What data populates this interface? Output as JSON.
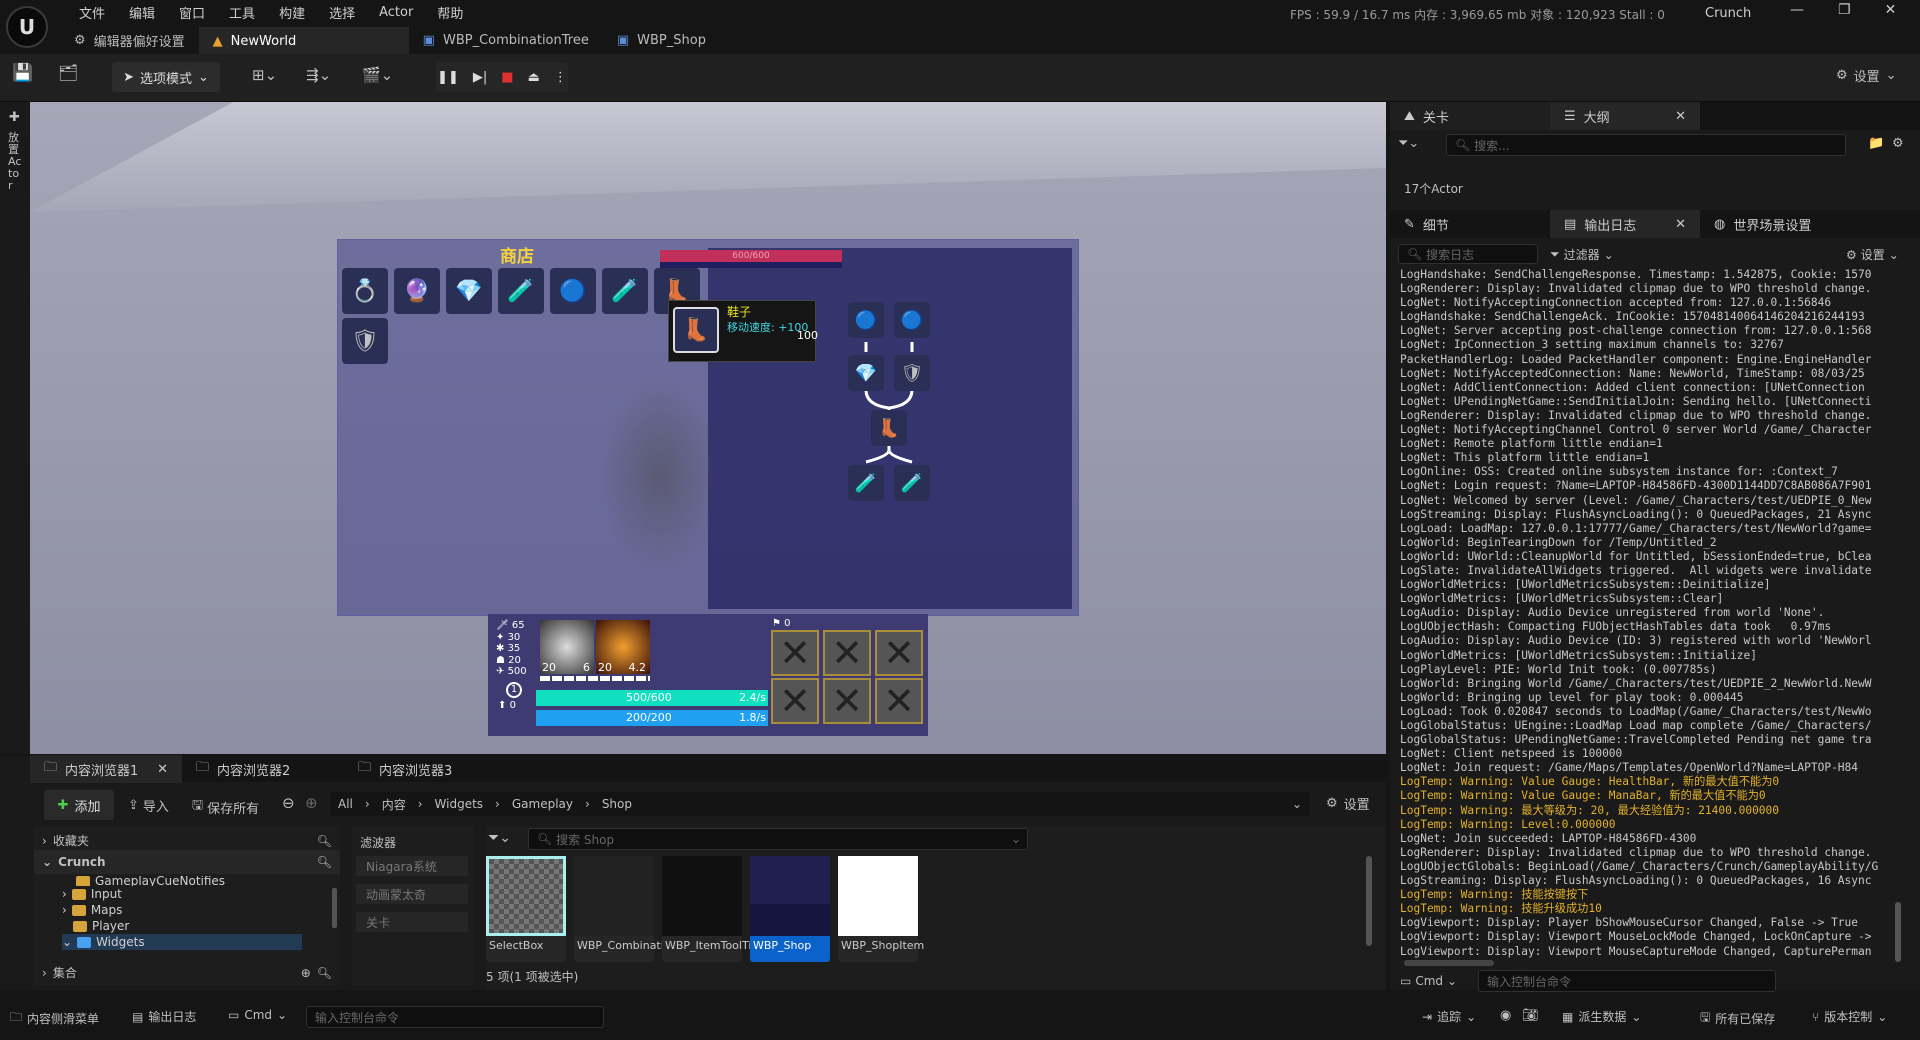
{
  "menu": [
    "文件",
    "编辑",
    "窗口",
    "工具",
    "构建",
    "选择",
    "Actor",
    "帮助"
  ],
  "doc_tabs": [
    "编辑器偏好设置",
    "NewWorld",
    "WBP_CombinationTree",
    "WBP_Shop"
  ],
  "stats": "FPS : 59.9 / 16.7 ms  内存 : 3,969.65 mb  对象 : 120,923  Stall : 0",
  "project": "Crunch",
  "toolbar": {
    "mode": "选项模式",
    "settings": "设置"
  },
  "left_strip": "放置Actor",
  "shop": {
    "title": "商店",
    "bar": "600/600",
    "tooltip_name": "鞋子",
    "tooltip_desc": "移动速度: +100",
    "tooltip_price": "100",
    "items": [
      "💍",
      "🔮",
      "💎",
      "🧪",
      "🔵",
      "🧪",
      "👢"
    ],
    "items_row2": [
      "🛡"
    ],
    "tree": [
      "🔵",
      "🔵",
      "💎",
      "🛡",
      "👢",
      "🧪",
      "🧪"
    ]
  },
  "hud": {
    "stats": [
      "65",
      "30",
      "35",
      "20",
      "500"
    ],
    "level": "1",
    "xp": "0",
    "ability1": {
      "cost": "20",
      "cd": "6"
    },
    "ability2": {
      "cost": "20",
      "cd": "4.2"
    },
    "health": "500/600",
    "health_regen": "2.4/s",
    "mana": "200/200",
    "mana_regen": "1.8/s",
    "gold": "0"
  },
  "right_panel": {
    "tabs_top": [
      "关卡",
      "大纲"
    ],
    "search_placeholder": "搜索...",
    "actor_count": "17个Actor",
    "tabs_mid": [
      "细节",
      "输出日志",
      "世界场景设置"
    ],
    "log_search_placeholder": "搜索日志",
    "filter": "过滤器",
    "settings": "设置",
    "cmd": "Cmd",
    "cmd_placeholder": "输入控制台命令"
  },
  "log_lines": [
    {
      "t": "LogHandshake: SendChallengeResponse. Timestamp: 1.542875, Cookie: 1570",
      "w": false
    },
    {
      "t": "LogRenderer: Display: Invalidated clipmap due to WPO threshold change.",
      "w": false
    },
    {
      "t": "LogNet: NotifyAcceptingConnection accepted from: 127.0.0.1:56846",
      "w": false
    },
    {
      "t": "LogHandshake: SendChallengeAck. InCookie: 157048140064146204216244193",
      "w": false
    },
    {
      "t": "LogNet: Server accepting post-challenge connection from: 127.0.0.1:568",
      "w": false
    },
    {
      "t": "LogNet: IpConnection_3 setting maximum channels to: 32767",
      "w": false
    },
    {
      "t": "PacketHandlerLog: Loaded PacketHandler component: Engine.EngineHandler",
      "w": false
    },
    {
      "t": "LogNet: NotifyAcceptedConnection: Name: NewWorld, TimeStamp: 08/03/25",
      "w": false
    },
    {
      "t": "LogNet: AddClientConnection: Added client connection: [UNetConnection",
      "w": false
    },
    {
      "t": "LogNet: UPendingNetGame::SendInitialJoin: Sending hello. [UNetConnecti",
      "w": false
    },
    {
      "t": "LogRenderer: Display: Invalidated clipmap due to WPO threshold change.",
      "w": false
    },
    {
      "t": "LogNet: NotifyAcceptingChannel Control 0 server World /Game/_Character",
      "w": false
    },
    {
      "t": "LogNet: Remote platform little endian=1",
      "w": false
    },
    {
      "t": "LogNet: This platform little endian=1",
      "w": false
    },
    {
      "t": "LogOnline: OSS: Created online subsystem instance for: :Context_7",
      "w": false
    },
    {
      "t": "LogNet: Login request: ?Name=LAPTOP-H84586FD-4300D1144DD7C8AB086A7F901",
      "w": false
    },
    {
      "t": "LogNet: Welcomed by server (Level: /Game/_Characters/test/UEDPIE_0_New",
      "w": false
    },
    {
      "t": "LogStreaming: Display: FlushAsyncLoading(): 0 QueuedPackages, 21 Async",
      "w": false
    },
    {
      "t": "LogLoad: LoadMap: 127.0.0.1:17777/Game/_Characters/test/NewWorld?game=",
      "w": false
    },
    {
      "t": "LogWorld: BeginTearingDown for /Temp/Untitled_2",
      "w": false
    },
    {
      "t": "LogWorld: UWorld::CleanupWorld for Untitled, bSessionEnded=true, bClea",
      "w": false
    },
    {
      "t": "LogSlate: InvalidateAllWidgets triggered.  All widgets were invalidate",
      "w": false
    },
    {
      "t": "LogWorldMetrics: [UWorldMetricsSubsystem::Deinitialize]",
      "w": false
    },
    {
      "t": "LogWorldMetrics: [UWorldMetricsSubsystem::Clear]",
      "w": false
    },
    {
      "t": "LogAudio: Display: Audio Device unregistered from world 'None'.",
      "w": false
    },
    {
      "t": "LogUObjectHash: Compacting FUObjectHashTables data took   0.97ms",
      "w": false
    },
    {
      "t": "LogAudio: Display: Audio Device (ID: 3) registered with world 'NewWorl",
      "w": false
    },
    {
      "t": "LogWorldMetrics: [UWorldMetricsSubsystem::Initialize]",
      "w": false
    },
    {
      "t": "LogPlayLevel: PIE: World Init took: (0.007785s)",
      "w": false
    },
    {
      "t": "LogWorld: Bringing World /Game/_Characters/test/UEDPIE_2_NewWorld.NewW",
      "w": false
    },
    {
      "t": "LogWorld: Bringing up level for play took: 0.000445",
      "w": false
    },
    {
      "t": "LogLoad: Took 0.020847 seconds to LoadMap(/Game/_Characters/test/NewWo",
      "w": false
    },
    {
      "t": "LogGlobalStatus: UEngine::LoadMap Load map complete /Game/_Characters/",
      "w": false
    },
    {
      "t": "LogGlobalStatus: UPendingNetGame::TravelCompleted Pending net game tra",
      "w": false
    },
    {
      "t": "LogNet: Client netspeed is 100000",
      "w": false
    },
    {
      "t": "LogNet: Join request: /Game/Maps/Templates/OpenWorld?Name=LAPTOP-H84",
      "w": false
    },
    {
      "t": "LogTemp: Warning: Value Gauge: HealthBar, 新的最大值不能为0",
      "w": true
    },
    {
      "t": "LogTemp: Warning: Value Gauge: ManaBar, 新的最大值不能为0",
      "w": true
    },
    {
      "t": "LogTemp: Warning: 最大等级为: 20, 最大经验值为: 21400.000000",
      "w": true
    },
    {
      "t": "LogTemp: Warning: Level:0.000000",
      "w": true
    },
    {
      "t": "LogNet: Join succeeded: LAPTOP-H84586FD-4300",
      "w": false
    },
    {
      "t": "LogRenderer: Display: Invalidated clipmap due to WPO threshold change.",
      "w": false
    },
    {
      "t": "LogUObjectGlobals: BeginLoad(/Game/_Characters/Crunch/GameplayAbility/G",
      "w": false
    },
    {
      "t": "LogStreaming: Display: FlushAsyncLoading(): 0 QueuedPackages, 16 Async",
      "w": false
    },
    {
      "t": "LogTemp: Warning: 技能按键按下",
      "w": true
    },
    {
      "t": "LogTemp: Warning: 技能升级成功10",
      "w": true
    },
    {
      "t": "LogViewport: Display: Player bShowMouseCursor Changed, False -> True",
      "w": false
    },
    {
      "t": "LogViewport: Display: Viewport MouseLockMode Changed, LockOnCapture ->",
      "w": false
    },
    {
      "t": "LogViewport: Display: Viewport MouseCaptureMode Changed, CapturePerman",
      "w": false
    }
  ],
  "content_browser": {
    "tabs": [
      "内容浏览器1",
      "内容浏览器2",
      "内容浏览器3"
    ],
    "add": "添加",
    "import": "导入",
    "save_all": "保存所有",
    "breadcrumbs": [
      "All",
      "内容",
      "Widgets",
      "Gameplay",
      "Shop"
    ],
    "settings": "设置",
    "favorites": "收藏夹",
    "root": "Crunch",
    "tree": [
      "GameplayCueNotifies",
      "Input",
      "Maps",
      "Player",
      "Widgets"
    ],
    "collections": "集合",
    "filters_title": "滤波器",
    "filters": [
      "Niagara系统",
      "动画蒙太奇",
      "关卡"
    ],
    "search_placeholder": "搜索 Shop",
    "assets": [
      "SelectBox",
      "WBP_Combinati...",
      "WBP_ItemToolTip",
      "WBP_Shop",
      "WBP_ShopItem"
    ],
    "status": "5 项(1 项被选中)"
  },
  "statusbar": {
    "drawer": "内容侧滑菜单",
    "output_log": "输出日志",
    "cmd": "Cmd",
    "cmd_placeholder": "输入控制台命令",
    "trace": "追踪",
    "derived": "派生数据",
    "saved": "所有已保存",
    "vcs": "版本控制"
  }
}
